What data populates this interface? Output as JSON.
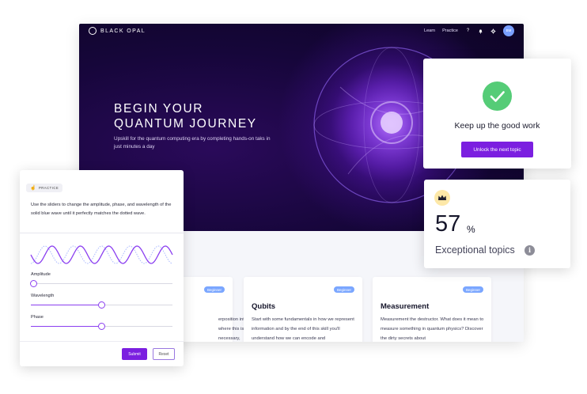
{
  "app": {
    "brand": "BLACK OPAL",
    "nav": {
      "learn": "Learn",
      "practice": "Practice",
      "avatar_initials": "BM"
    },
    "hero": {
      "title_line1": "BEGIN YOUR",
      "title_line2": "QUANTUM JOURNEY",
      "subtitle": "Upskill for the quantum computing era by completing hands-on taks in just minutes a day"
    },
    "topics": [
      {
        "badge": "Beginner",
        "title": "",
        "description": "erposition into where this is necessary,"
      },
      {
        "badge": "Beginner",
        "title": "Qubits",
        "description": "Start with some fundamentals in how we represent information and by the end of this skill you'll understand how we can encode and"
      },
      {
        "badge": "Beginner",
        "title": "Measurement",
        "description": "Measurement the destructor. What does it mean to measure something in quantum physics? Discover the dirty secrets about"
      }
    ]
  },
  "practice": {
    "chip_label": "PRACTICE",
    "instructions": "Use the sliders to change the amplitude, phase, and wavelength of the solid blue wave until it perfectly matches the dotted wave.",
    "sliders": [
      {
        "label": "Amplitude",
        "value": 0.02
      },
      {
        "label": "Wavelength",
        "value": 0.5
      },
      {
        "label": "Phase",
        "value": 0.5
      }
    ],
    "submit_label": "Submit",
    "reset_label": "Reset"
  },
  "success": {
    "message": "Keep up the good work",
    "button_label": "Unlock the next topic",
    "check_color": "#55cc77"
  },
  "stats": {
    "value": "57",
    "unit": "%",
    "label": "Exceptional topics",
    "info_glyph": "i"
  },
  "colors": {
    "accent": "#7b1fe0",
    "badge": "#7aa6ff",
    "wave_solid": "#8b3ff0",
    "wave_dotted": "#a9b8ff"
  }
}
